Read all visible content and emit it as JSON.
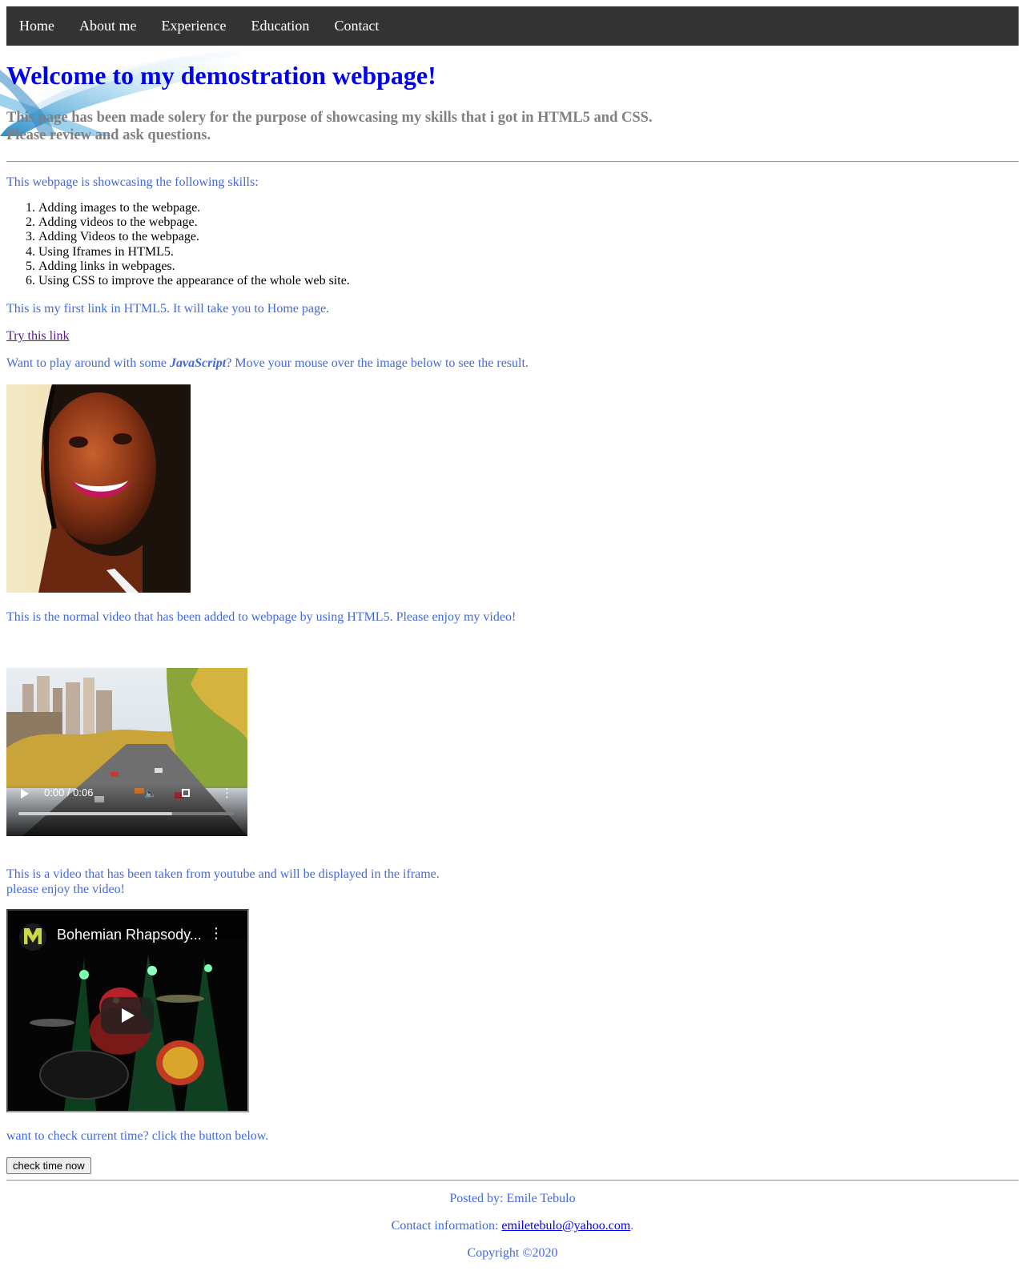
{
  "nav": {
    "items": [
      {
        "label": "Home"
      },
      {
        "label": "About me"
      },
      {
        "label": "Experience"
      },
      {
        "label": "Education"
      },
      {
        "label": "Contact"
      }
    ]
  },
  "header": {
    "title": "Welcome to my demostration webpage!",
    "intro_line1": "This page has been made solery for the purpose of showcasing my skills that i got in HTML5 and CSS.",
    "intro_line2": "Please review and ask questions."
  },
  "skills": {
    "heading": "This webpage is showcasing the following skills:",
    "items": [
      "Adding images to the webpage.",
      "Adding videos to the webpage.",
      "Adding Videos to the webpage.",
      "Using Iframes in HTML5.",
      "Adding links in webpages.",
      "Using CSS to improve the appearance of the whole web site."
    ]
  },
  "link_section": {
    "text": "This is my first link in HTML5. It will take you to Home page.",
    "link_label": "Try this link"
  },
  "js_section": {
    "text_before": "Want to play around with some ",
    "emphasis": "JavaScript",
    "text_after": "? Move your mouse over the image below to see the result."
  },
  "video_section": {
    "text": "This is the normal video that has been added to webpage by using HTML5. Please enjoy my video!",
    "time": "0:00 / 0:06",
    "progress": 0.71
  },
  "iframe_section": {
    "line1": "This is a video that has been taken from youtube and will be displayed in the iframe.",
    "line2": "please enjoy the video!",
    "video_title": "Bohemian Rhapsody..."
  },
  "time_section": {
    "text": "want to check current time? click the button below.",
    "button_label": "check time now"
  },
  "footer": {
    "posted_by": "Posted by: Emile Tebulo",
    "contact_label": "Contact information: ",
    "email": "emiletebulo@yahoo.com",
    "copyright": "Copyright ©2020"
  }
}
